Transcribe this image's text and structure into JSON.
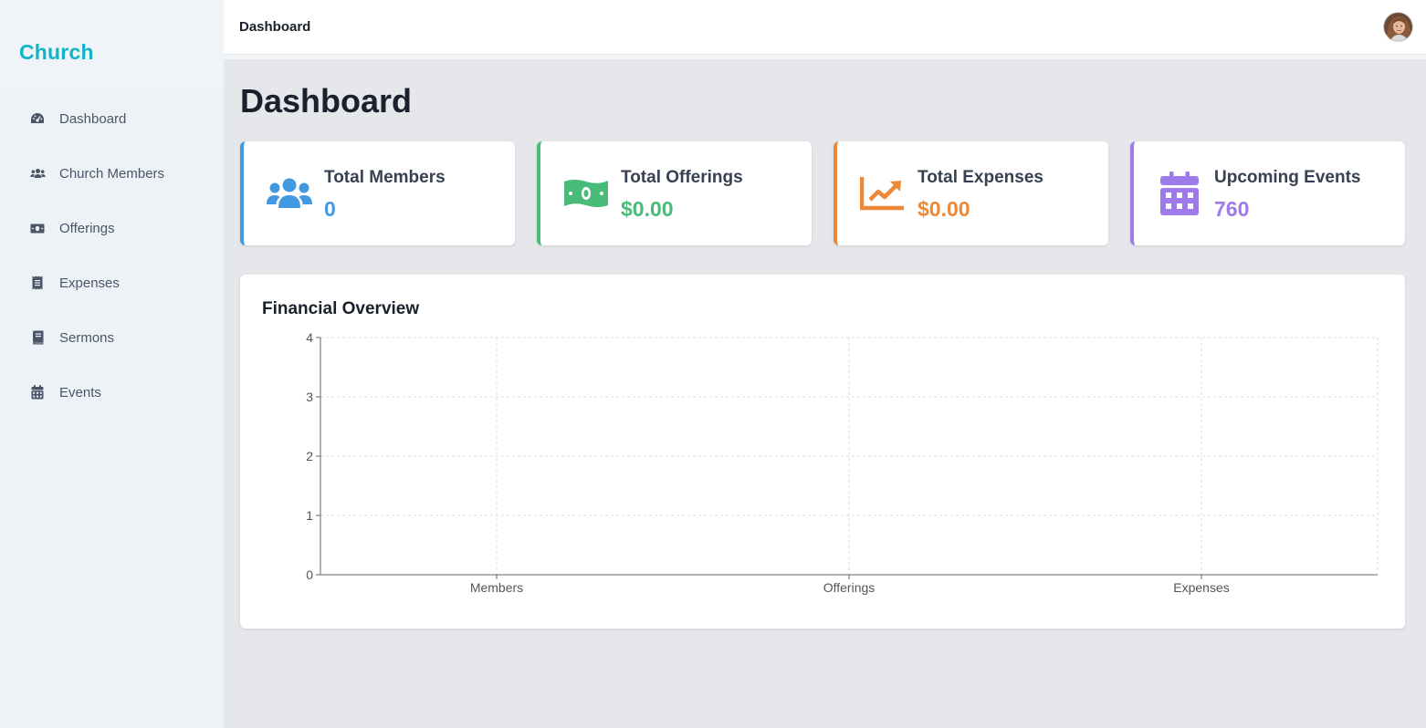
{
  "sidebar": {
    "brand": "Church",
    "items": [
      {
        "label": "Dashboard",
        "icon": "gauge-icon"
      },
      {
        "label": "Church Members",
        "icon": "users-icon"
      },
      {
        "label": "Offerings",
        "icon": "money-bill-icon"
      },
      {
        "label": "Expenses",
        "icon": "receipt-icon"
      },
      {
        "label": "Sermons",
        "icon": "book-icon"
      },
      {
        "label": "Events",
        "icon": "calendar-icon"
      }
    ]
  },
  "header": {
    "title": "Dashboard"
  },
  "main": {
    "title": "Dashboard",
    "cards": [
      {
        "label": "Total Members",
        "value": "0",
        "color": "#4299e1",
        "icon": "users-icon"
      },
      {
        "label": "Total Offerings",
        "value": "$0.00",
        "color": "#48bb78",
        "icon": "money-bill-icon"
      },
      {
        "label": "Total Expenses",
        "value": "$0.00",
        "color": "#ed8936",
        "icon": "chart-line-icon"
      },
      {
        "label": "Upcoming Events",
        "value": "760",
        "color": "#9f7aea",
        "icon": "calendar-icon"
      }
    ],
    "chart_title": "Financial Overview"
  },
  "chart_data": {
    "type": "bar",
    "title": "Financial Overview",
    "categories": [
      "Members",
      "Offerings",
      "Expenses"
    ],
    "values": [
      0,
      0,
      0
    ],
    "ylim": [
      0,
      4
    ],
    "yticks": [
      0,
      1,
      2,
      3,
      4
    ],
    "grid": true,
    "legend": "none"
  }
}
